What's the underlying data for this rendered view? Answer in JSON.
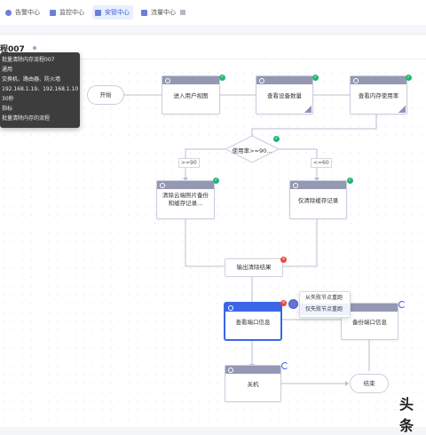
{
  "tabs": [
    {
      "label": "告警中心",
      "icon": "alert-icon"
    },
    {
      "label": "监控中心",
      "icon": "monitor-icon"
    },
    {
      "label": "安管中心",
      "icon": "security-icon"
    },
    {
      "label": "流量中心",
      "icon": "traffic-icon"
    }
  ],
  "active_tab": "安管中心",
  "page_title": "程007",
  "tooltip": {
    "lines": [
      "批量清除内存流程007",
      "通用",
      "交换机、路由器、防火墙",
      "192.168.1.19、192.168.1.10",
      "30秒",
      "指标",
      "批量清除内存的流程"
    ]
  },
  "nodes": {
    "start": "开始",
    "enter_user_view": "进入用户视图",
    "check_device_count": "查看设备数量",
    "check_memory_usage": "查看内存使用率",
    "decision": "使用率>=90...",
    "clear_cloud_backup": "清除云端照片备份和缓存记录...",
    "clear_cache_only": "仅清除缓存记录",
    "output_result": "输出清除结果",
    "check_port_info": "查看端口信息",
    "backup_port_info": "备份端口信息",
    "shutdown": "关机",
    "end": "结束"
  },
  "edge_labels": {
    "left_branch": ">=90",
    "right_branch": "<=60"
  },
  "context_menu": [
    "从失败节点重跑",
    "仅失败节点重跑"
  ],
  "watermark": "头条",
  "colors": {
    "accent": "#3b66e6",
    "node_header": "#9498b3",
    "success": "#22b573",
    "error": "#e8453c"
  }
}
